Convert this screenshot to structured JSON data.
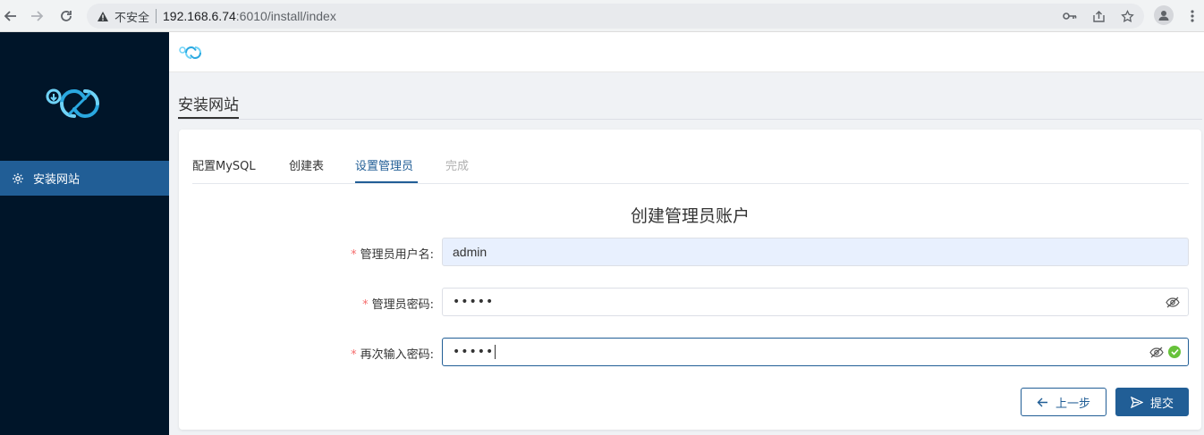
{
  "browser": {
    "insecure_label": "不安全",
    "url_host": "192.168.6.74",
    "url_path": ":6010/install/index"
  },
  "sidebar": {
    "items": [
      {
        "label": "安装网站",
        "icon": "gear-icon",
        "active": true
      }
    ]
  },
  "page": {
    "tab_title": "安装网站"
  },
  "steps": [
    {
      "label": "配置MySQL",
      "state": "normal"
    },
    {
      "label": "创建表",
      "state": "normal"
    },
    {
      "label": "设置管理员",
      "state": "active"
    },
    {
      "label": "完成",
      "state": "disabled"
    }
  ],
  "form": {
    "title": "创建管理员账户",
    "username_label": "管理员用户名:",
    "username_value": "admin",
    "password_label": "管理员密码:",
    "password_value": "•••••",
    "confirm_label": "再次输入密码:",
    "confirm_value": "•••••",
    "required_mark": "*"
  },
  "buttons": {
    "prev_label": "上一步",
    "submit_label": "提交"
  },
  "colors": {
    "sidebar_bg": "#001529",
    "accent": "#215e96",
    "success": "#67c23a",
    "required": "#f56c6c"
  }
}
